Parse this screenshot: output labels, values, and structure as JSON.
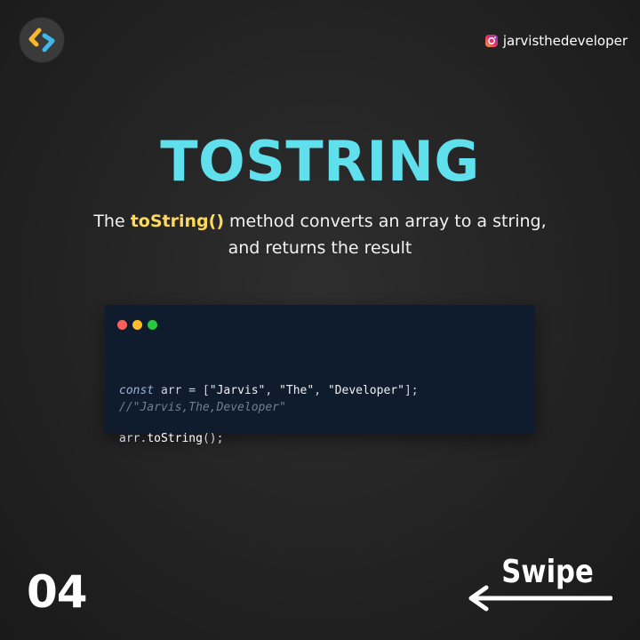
{
  "brand": {
    "logo_icon": "code-brackets-logo-icon",
    "handle_icon": "instagram-icon",
    "handle": "jarvisthedeveloper"
  },
  "slide": {
    "title": "TOSTRING",
    "description": {
      "prefix": "The ",
      "highlight": "toString()",
      "line1_rest": " method converts an array to a string,",
      "line2": "and returns the result"
    },
    "code": {
      "line1": {
        "kw": "const",
        "var": " arr = [",
        "s1": "\"Jarvis\"",
        "c1": ", ",
        "s2": "\"The\"",
        "c2": ", ",
        "s3": "\"Developer\"",
        "end": "];"
      },
      "line2": {
        "obj": "arr.",
        "method": "toString",
        "end": "();"
      },
      "comment": "//\"Jarvis,The,Developer\""
    },
    "page_number": "04",
    "swipe_label": "Swipe",
    "swipe_icon": "arrow-left-icon"
  },
  "colors": {
    "title": "#5fe0ec",
    "highlight": "#ffd95a",
    "code_bg": "#0f1c2e"
  }
}
